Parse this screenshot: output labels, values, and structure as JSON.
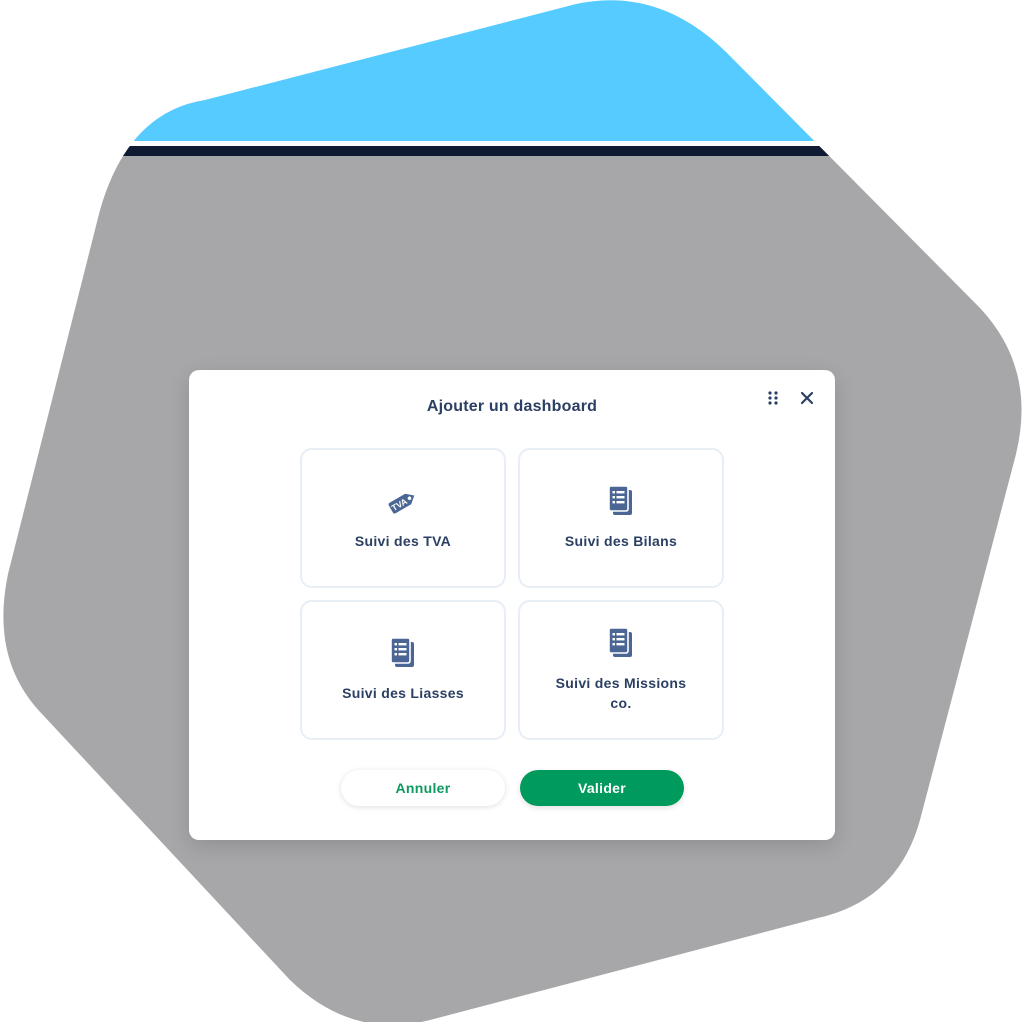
{
  "colors": {
    "hexagon_top": "#55cbff",
    "hexagon_body": "#a7a7a9",
    "header_strip": "#0f1b33",
    "title_text": "#2b3f63",
    "icon": "#4b6694",
    "card_border": "#e7eef6",
    "accent_green": "#009a5c"
  },
  "modal": {
    "title": "Ajouter un dashboard",
    "drag_icon": "grip-dots-icon",
    "close_icon": "close-icon"
  },
  "cards": [
    {
      "label": "Suivi des TVA",
      "icon": "tva-tag-icon"
    },
    {
      "label": "Suivi des Bilans",
      "icon": "document-list-icon"
    },
    {
      "label": "Suivi des Liasses",
      "icon": "document-list-icon"
    },
    {
      "label": "Suivi des Missions co.",
      "icon": "document-list-icon"
    }
  ],
  "actions": {
    "cancel_label": "Annuler",
    "confirm_label": "Valider"
  }
}
